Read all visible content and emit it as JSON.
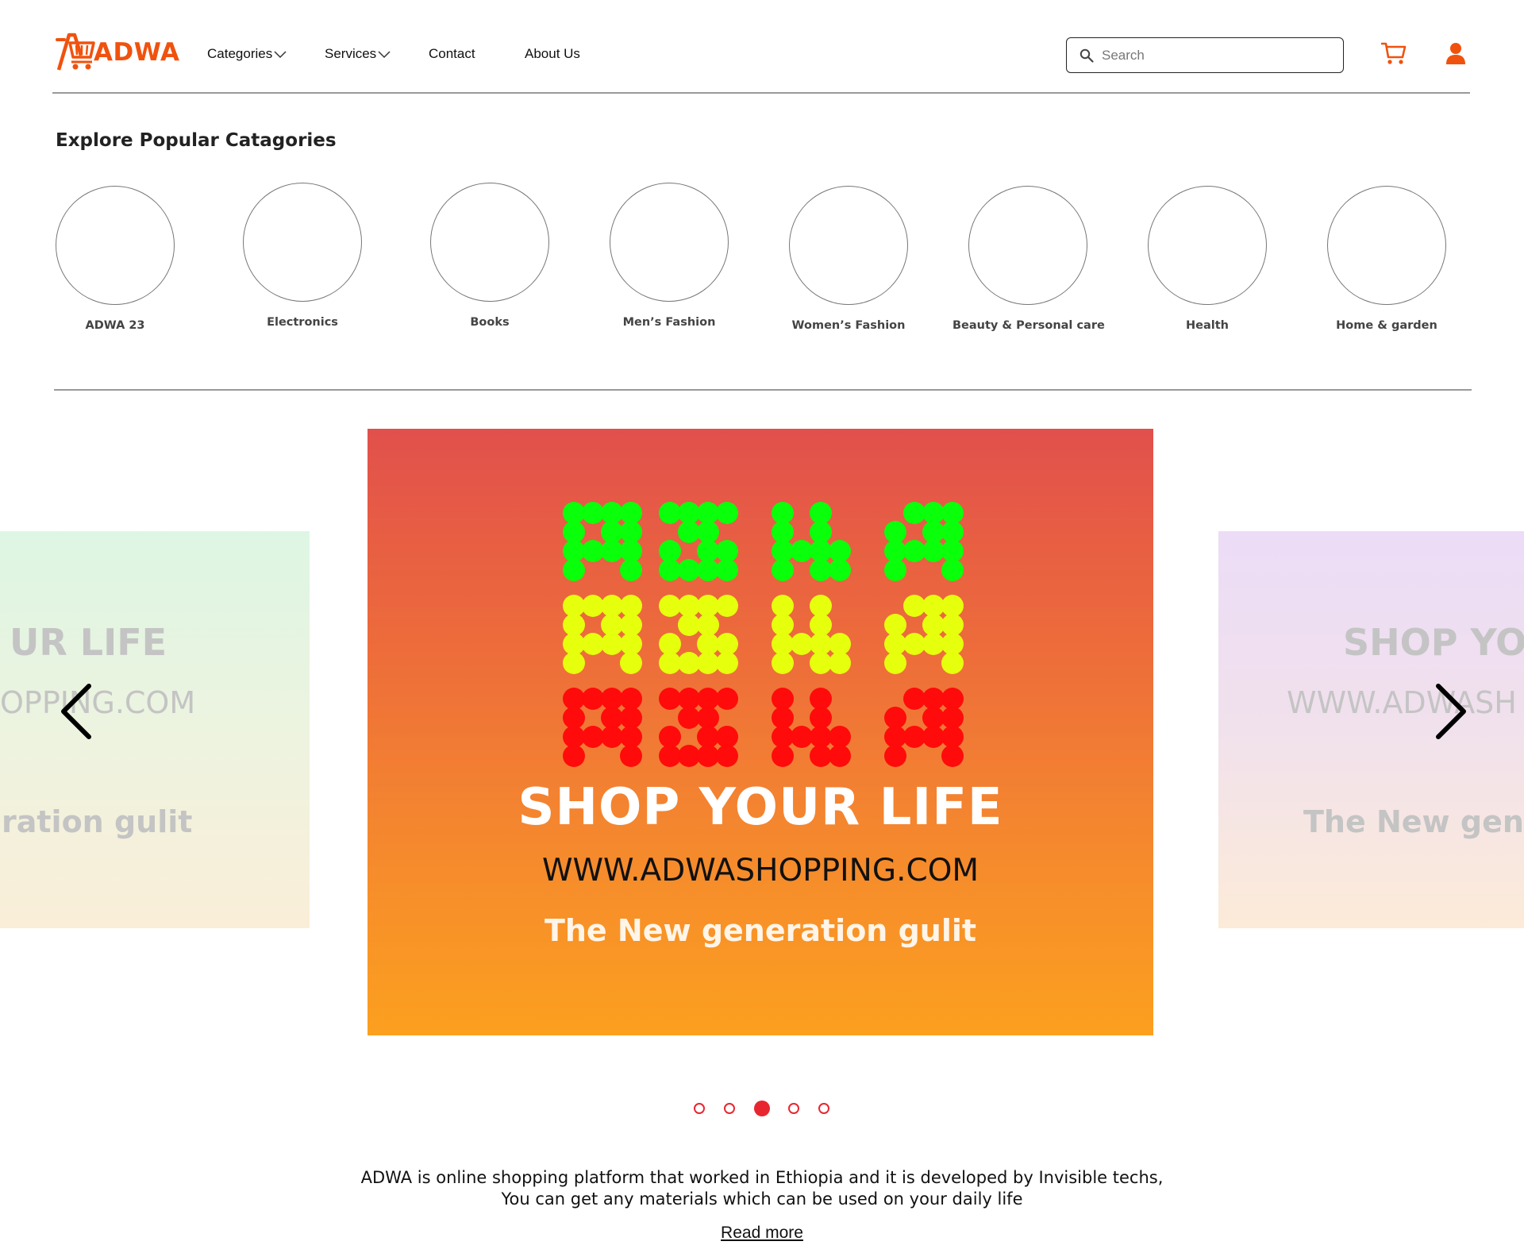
{
  "header": {
    "logo_text": "ADWA",
    "logo_icon": "cart-a-logo-icon",
    "brand_color": "#f0520e",
    "nav": {
      "categories": "Categories",
      "services": "Services",
      "contact": "Contact",
      "about": "About Us"
    },
    "search": {
      "placeholder": "Search",
      "icon": "search-icon"
    },
    "cart_icon": "cart-icon",
    "user_icon": "user-icon"
  },
  "categories": {
    "title": "Explore Popular Catagories",
    "items": [
      {
        "label": "ADWA 23"
      },
      {
        "label": "Electronics"
      },
      {
        "label": "Books"
      },
      {
        "label": "Men’s Fashion"
      },
      {
        "label": "Women’s Fashion"
      },
      {
        "label": "Beauty & Personal care"
      },
      {
        "label": "Health"
      },
      {
        "label": "Home & garden"
      }
    ]
  },
  "carousel": {
    "main": {
      "art_rows": [
        "ADWA (Ge'ez dot-matrix, green)",
        "ADWA (Ge'ez dot-matrix, yellow)",
        "ADWA (Ge'ez dot-matrix, red)"
      ],
      "art_colors": [
        "#0aff0a",
        "#e6ff0c",
        "#ff0b0b"
      ],
      "title": "SHOP YOUR LIFE",
      "url": "WWW.ADWASHOPPING.COM",
      "tagline": "The New generation gulit"
    },
    "left_preview": {
      "title": "UR LIFE",
      "url": "OPPING.COM",
      "tagline": "ration gulit"
    },
    "right_preview": {
      "title": "SHOP YO",
      "url": "WWW.ADWASH",
      "tagline": "The New gene"
    },
    "prev_icon": "chevron-left-icon",
    "next_icon": "chevron-right-icon",
    "indicator_count": 5,
    "active_index": 2,
    "indicator_color": "#e8262f"
  },
  "about": {
    "line1": "ADWA is online shopping platform that worked in Ethiopia and it is developed by Invisible techs,",
    "line2": "You can get any materials which can be used on your daily life",
    "read_more": "Read more"
  }
}
